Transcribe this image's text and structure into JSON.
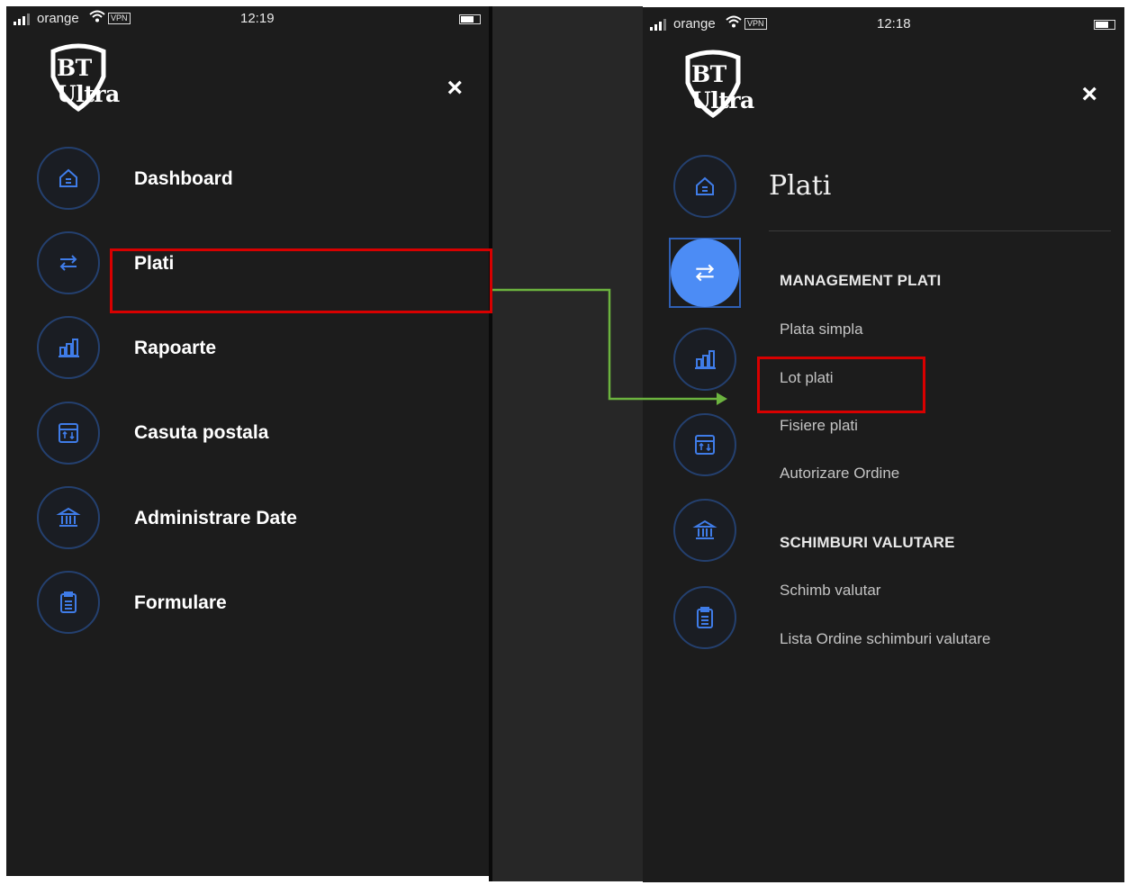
{
  "status_left": {
    "carrier": "orange",
    "vpn": "VPN",
    "time": "12:19"
  },
  "status_right": {
    "carrier": "orange",
    "vpn": "VPN",
    "time": "12:18"
  },
  "brand": {
    "logo_text": "BT Ultra"
  },
  "close_icon": "×",
  "menu": {
    "items": [
      {
        "label": "Dashboard",
        "icon": "home-icon"
      },
      {
        "label": "Plati",
        "icon": "transfer-icon"
      },
      {
        "label": "Rapoarte",
        "icon": "chart-icon"
      },
      {
        "label": "Casuta postala",
        "icon": "mailbox-icon"
      },
      {
        "label": "Administrare Date",
        "icon": "bank-icon"
      },
      {
        "label": "Formulare",
        "icon": "clipboard-icon"
      }
    ]
  },
  "submenu": {
    "title": "Plati",
    "sections": [
      {
        "heading": "MANAGEMENT PLATI",
        "items": [
          "Plata simpla",
          "Lot plati",
          "Fisiere plati",
          "Autorizare Ordine"
        ]
      },
      {
        "heading": "SCHIMBURI VALUTARE",
        "items": [
          "Schimb valutar",
          "Lista Ordine schimburi valutare"
        ]
      }
    ]
  },
  "colors": {
    "background": "#1c1c1c",
    "accent": "#4c8cf5",
    "circle_border": "#24406f",
    "highlight": "#d80000",
    "arrow": "#6cb33f"
  }
}
